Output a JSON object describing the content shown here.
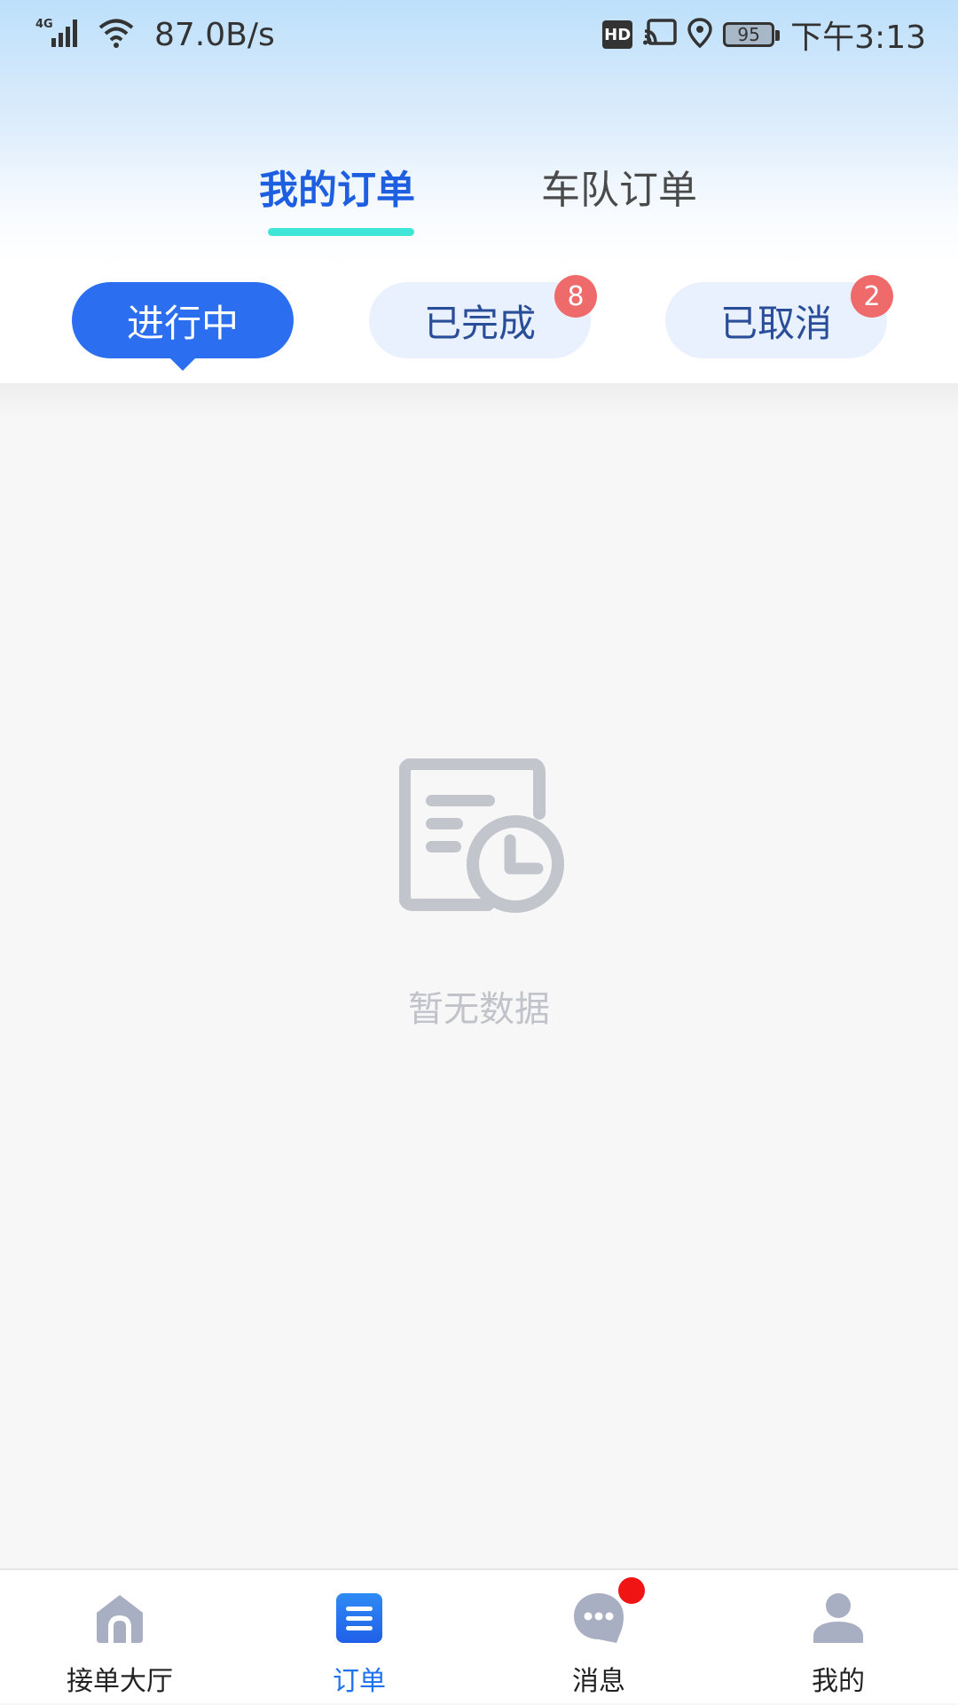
{
  "status_bar": {
    "network_type": "4G",
    "net_speed": "87.0B/s",
    "hd_label": "HD",
    "battery_level": "95",
    "time": "下午3:13"
  },
  "top_tabs": [
    {
      "label": "我的订单",
      "active": true
    },
    {
      "label": "车队订单",
      "active": false
    }
  ],
  "filters": [
    {
      "label": "进行中",
      "active": true,
      "badge": ""
    },
    {
      "label": "已完成",
      "active": false,
      "badge": "8"
    },
    {
      "label": "已取消",
      "active": false,
      "badge": "2"
    }
  ],
  "empty_state": {
    "icon": "order-clock-icon",
    "text": "暂无数据"
  },
  "bottom_nav": [
    {
      "label": "接单大厅",
      "icon": "home-icon",
      "active": false
    },
    {
      "label": "订单",
      "icon": "order-list-icon",
      "active": true
    },
    {
      "label": "消息",
      "icon": "message-icon",
      "active": false,
      "dot": true
    },
    {
      "label": "我的",
      "icon": "user-icon",
      "active": false
    }
  ],
  "colors": {
    "primary": "#2b6ff0",
    "active_tab_text": "#1d5fe0",
    "tab_indicator": "#3fe5d6",
    "badge": "#ef6a6a",
    "notification_dot": "#f01414",
    "icon_gray": "#a9afc2",
    "empty_gray": "#c0c3c9"
  }
}
